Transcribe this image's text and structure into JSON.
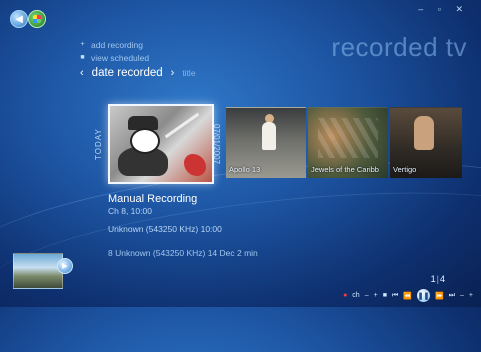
{
  "header": {
    "title": "recorded tv",
    "window_controls": "– ▫ ✕"
  },
  "menu": {
    "items": [
      {
        "icon": "plus-icon",
        "glyph": "+",
        "label": "add recording"
      },
      {
        "icon": "list-icon",
        "glyph": "■",
        "label": "view scheduled"
      }
    ]
  },
  "sort": {
    "prev_glyph": "‹",
    "active": "date recorded",
    "next_glyph": "›",
    "alt": "title"
  },
  "strip": {
    "group_label": "TODAY",
    "group_date": "07/01/2007",
    "items": [
      {
        "label": "Apollo 13"
      },
      {
        "label": "Jewels of the Caribb"
      },
      {
        "label": "Vertigo"
      }
    ]
  },
  "details": {
    "title": "Manual Recording",
    "time": "Ch 8, 10:00",
    "channel": "Unknown (543250 KHz) 10:00",
    "bottom_line": "8 Unknown (543250 KHz)  14 Dec  2 min"
  },
  "pager": {
    "current": "1",
    "total": "4"
  },
  "transport": {
    "rec": "●",
    "ch": "ch",
    "minus": "–",
    "plus": "+",
    "stop": "■",
    "prev": "⏮",
    "rewind": "⏪",
    "play": "❚❚",
    "ffwd": "⏩",
    "next": "⏭",
    "vol_minus": "–",
    "vol_plus": "+"
  },
  "colors": {
    "background": "#1d55a3",
    "accent": "#cfe6ff",
    "record": "#ff3a3a"
  }
}
